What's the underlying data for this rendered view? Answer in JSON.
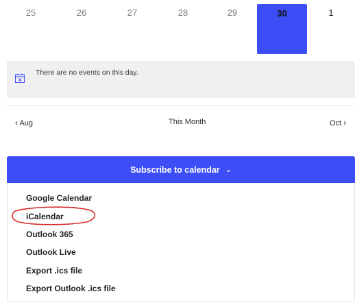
{
  "calendar": {
    "days": [
      {
        "label": "25"
      },
      {
        "label": "26"
      },
      {
        "label": "27"
      },
      {
        "label": "28"
      },
      {
        "label": "29"
      },
      {
        "label": "30"
      },
      {
        "label": "1"
      }
    ],
    "selected_day": "30",
    "accent_color": "#3d4ef6",
    "no_events_text": "There are no events on this day.",
    "calendar_icon": "calendar-x-icon"
  },
  "month_nav": {
    "prev_label": "Aug",
    "current_label": "This Month",
    "next_label": "Oct"
  },
  "subscribe": {
    "label": "Subscribe to calendar",
    "caret_icon": "chevron-down-icon",
    "options": [
      {
        "label": "Google Calendar"
      },
      {
        "label": "iCalendar"
      },
      {
        "label": "Outlook 365"
      },
      {
        "label": "Outlook Live"
      },
      {
        "label": "Export .ics file"
      },
      {
        "label": "Export Outlook .ics file"
      }
    ]
  },
  "annotation_color": "#d42b2b"
}
